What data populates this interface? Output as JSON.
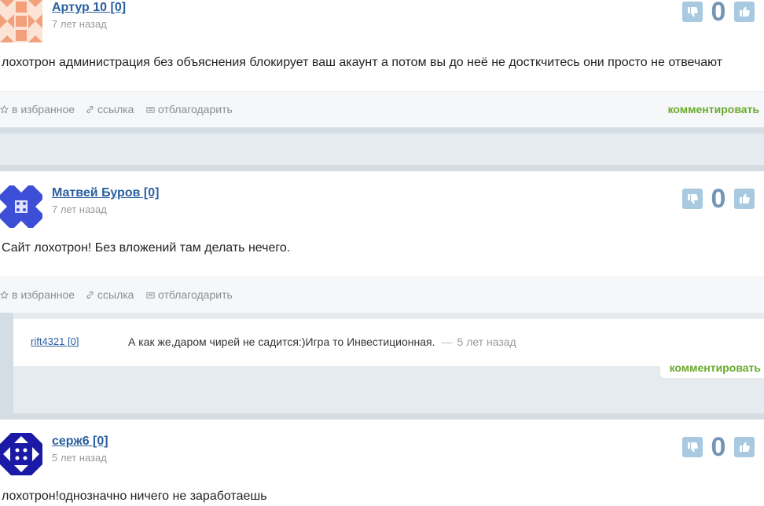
{
  "actions": {
    "favorite": "в избранное",
    "link": "ссылка",
    "thank": "отблагодарить",
    "comment": "комментировать"
  },
  "posts": [
    {
      "author": "Артур 10 [0]",
      "ago": "7 лет назад",
      "text": "лохотрон администрация без объяснения блокирует ваш акаунт а потом вы до неё не досткчитесь они просто не отвечают",
      "score": "0",
      "avatar_color": "#f2a07c"
    },
    {
      "author": "Матвей Буров [0]",
      "ago": "7 лет назад",
      "text": "Сайт лохотрон! Без вложений там делать нечего.",
      "score": "0",
      "avatar_color": "#3c4fd6"
    },
    {
      "author": "серж6 [0]",
      "ago": "5 лет назад",
      "text": "лохотрон!однозначно ничего не заработаешь",
      "score": "0",
      "avatar_color": "#1a1aa6"
    }
  ],
  "reply": {
    "author": "rift4321 [0]",
    "text": "А как же,даром чирей не садится:)Игра то Инвестиционная.",
    "dash": "—",
    "ago": "5 лет назад"
  },
  "colors": {
    "accent_link": "#2a5f9e",
    "comment_green": "#6aaa2c",
    "vote_button": "#a8c9e0",
    "score": "#7496b4"
  }
}
